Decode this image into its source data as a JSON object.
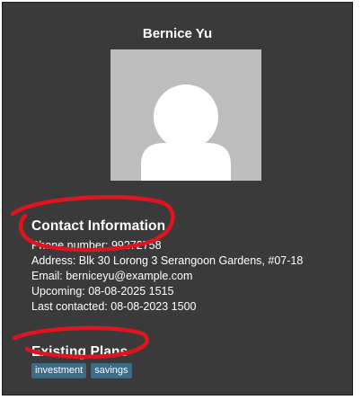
{
  "profile": {
    "name": "Bernice Yu",
    "avatar_icon": "person-placeholder-icon"
  },
  "contact": {
    "title": "Contact Information",
    "phone": "Phone number: 99272758",
    "address": "Address: Blk 30 Lorong 3 Serangoon Gardens, #07-18",
    "email": "Email: berniceyu@example.com",
    "upcoming": "Upcoming: 08-08-2025 1515",
    "last_contacted": "Last contacted: 08-08-2023 1500"
  },
  "plans": {
    "title": "Existing Plans",
    "tags": [
      "investment",
      "savings"
    ]
  },
  "colors": {
    "panel_bg": "#3a3a3a",
    "tag_bg": "#3d6a85",
    "annotation": "#e0141e",
    "avatar_bg": "#bdbdbd"
  }
}
